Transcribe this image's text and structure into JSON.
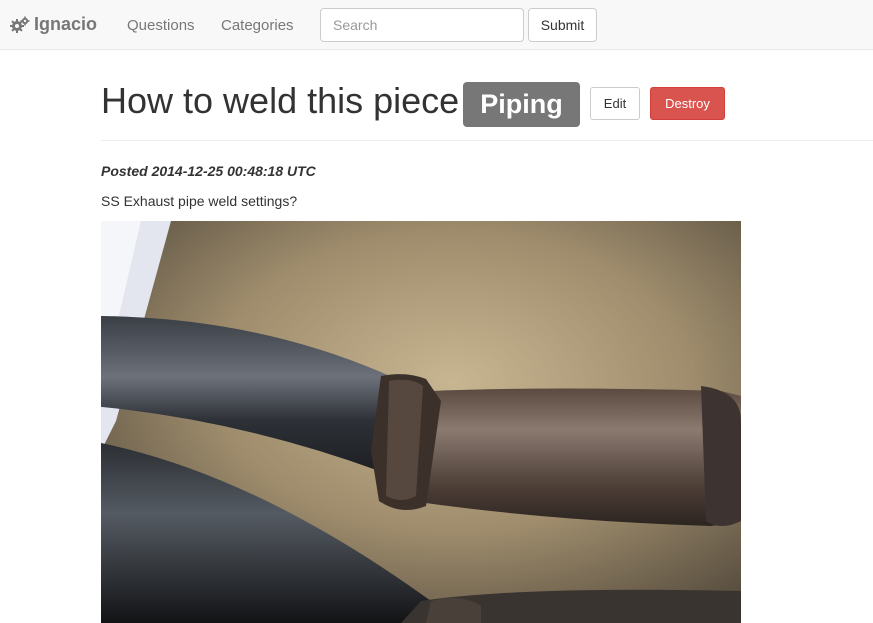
{
  "navbar": {
    "brand": "Ignacio",
    "brand_icon": "gears-icon",
    "links": [
      "Questions",
      "Categories"
    ],
    "search": {
      "placeholder": "Search",
      "value": ""
    },
    "submit_label": "Submit"
  },
  "question": {
    "title": "How to weld this piece",
    "category": "Piping",
    "edit_label": "Edit",
    "destroy_label": "Destroy",
    "posted_label": "Posted",
    "posted_at": "2014-12-25 00:48:18 UTC",
    "body": "SS Exhaust pipe weld settings?"
  },
  "colors": {
    "navbar_bg": "#f8f8f8",
    "badge_bg": "#777777",
    "destroy_bg": "#d9534f"
  }
}
